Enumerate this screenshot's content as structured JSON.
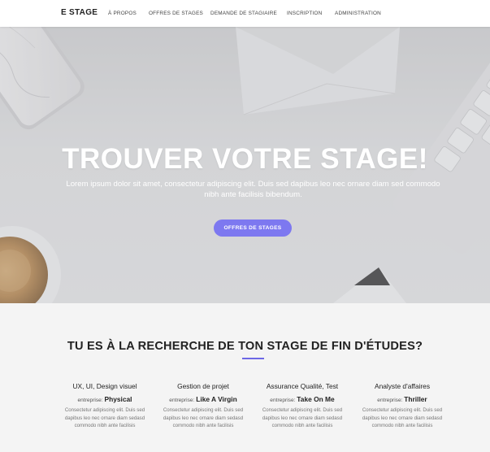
{
  "nav": {
    "brand": "E STAGE",
    "items": [
      {
        "label": "À PROPOS"
      },
      {
        "label": "OFFRES DE STAGES"
      },
      {
        "label": "DEMANDE DE STAGIAIRE"
      },
      {
        "label": "INSCRIPTION"
      },
      {
        "label": "ADMINISTRATION"
      }
    ]
  },
  "hero": {
    "title": "TROUVER VOTRE STAGE!",
    "subtitle": "Lorem ipsum dolor sit amet, consectetur adipiscing elit. Duis sed dapibus leo nec ornare diam sed commodo nibh ante facilisis bibendum.",
    "button_label": "OFFRES DE STAGES"
  },
  "section": {
    "title": "TU ES À LA RECHERCHE DE TON STAGE DE FIN D'ÉTUDES?",
    "company_prefix": "entreprise:",
    "cards": [
      {
        "title": "UX, UI, Design visuel",
        "company": "Physical",
        "description": "Consectetur adipiscing elit. Duis sed dapibus leo nec ornare diam sedasd commodo nibh ante facilisis"
      },
      {
        "title": "Gestion de projet",
        "company": "Like A Virgin",
        "description": "Consectetur adipiscing elit. Duis sed dapibus leo nec ornare diam sedasd commodo nibh ante facilisis"
      },
      {
        "title": "Assurance Qualité, Test",
        "company": "Take On Me",
        "description": "Consectetur adipiscing elit. Duis sed dapibus leo nec ornare diam sedasd commodo nibh ante facilisis"
      },
      {
        "title": "Analyste d'affaires",
        "company": "Thriller",
        "description": "Consectetur adipiscing elit. Duis sed dapibus leo nec ornare diam sedasd commodo nibh ante facilisis"
      }
    ]
  },
  "colors": {
    "accent": "#7d78f0",
    "rule": "#6d68e6",
    "nav_bg": "#ffffff",
    "section_bg": "#f4f4f4"
  }
}
